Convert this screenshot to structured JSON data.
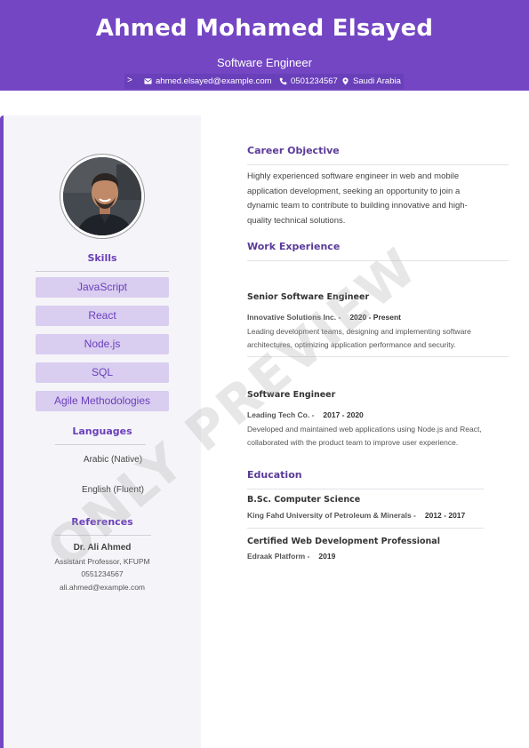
{
  "header": {
    "name": "Ahmed Mohamed Elsayed",
    "title": "Software Engineer",
    "contact": {
      "chevron": ">",
      "email": "ahmed.elsayed@example.com",
      "phone": "0501234567",
      "location": "Saudi Arabia"
    },
    "background_color": "#7446c4"
  },
  "sidebar": {
    "skills_heading": "Skills",
    "skills": [
      "JavaScript",
      "React",
      "Node.js",
      "SQL",
      "Agile Methodologies"
    ],
    "languages_heading": "Languages",
    "languages": [
      "Arabic (Native)",
      "English (Fluent)"
    ],
    "references_heading": "References",
    "reference": {
      "name": "Dr. Ali Ahmed",
      "role": "Assistant Professor, KFUPM",
      "phone": "0551234567",
      "email": "ali.ahmed@example.com"
    }
  },
  "main": {
    "objective_heading": "Career Objective",
    "objective_lines": [
      "Highly experienced software engineer in web and mobile",
      "application development, seeking an opportunity to join a",
      "dynamic team to contribute to building innovative and high-",
      "quality technical solutions."
    ],
    "experience_heading": "Work Experience",
    "experience": [
      {
        "title": "Senior Software Engineer",
        "company": "Innovative Solutions Inc. -",
        "dates": "2020 - Present",
        "desc_lines": [
          "Leading development teams, designing and implementing software",
          "architectures, optimizing application performance and security."
        ]
      },
      {
        "title": "Software Engineer",
        "company": "Leading Tech Co. -",
        "dates": "2017 - 2020",
        "desc_lines": [
          "Developed and maintained web applications using Node.js and React,",
          "collaborated with the product team to improve user experience."
        ]
      }
    ],
    "education_heading": "Education",
    "education": [
      {
        "title": "B.Sc. Computer Science",
        "school": "King Fahd University of Petroleum & Minerals -",
        "dates": "2012 - 2017"
      },
      {
        "title": "Certified Web Development Professional",
        "school": "Edraak Platform -",
        "dates": "2019"
      }
    ]
  },
  "watermark": "ONLY PREVIEW",
  "colors": {
    "accent": "#7446c4",
    "skill_bg": "#d9cdf0",
    "heading": "#5a3a99"
  },
  "icons": [
    "chevron-right-icon",
    "mail-icon",
    "phone-icon",
    "location-icon"
  ]
}
